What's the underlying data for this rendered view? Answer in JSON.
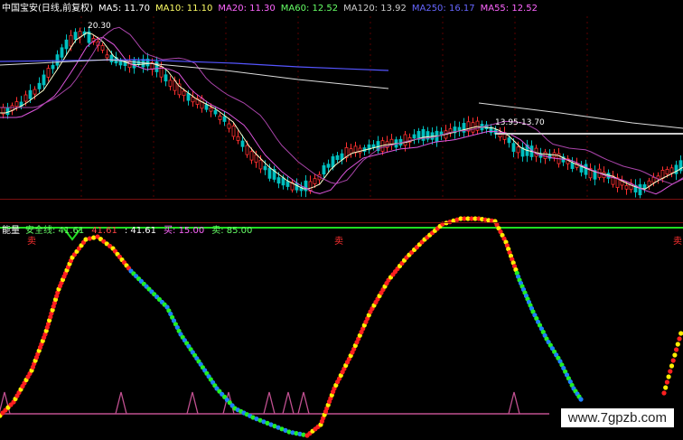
{
  "top_panel": {
    "title": "中国宝安(日线,前复权)",
    "ma": [
      {
        "label": "MA5: 11.70",
        "color": "#ffffff"
      },
      {
        "label": "MA10: 11.10",
        "color": "#ffff66"
      },
      {
        "label": "MA20: 11.30",
        "color": "#ff66ff"
      },
      {
        "label": "MA60: 12.52",
        "color": "#66ff66"
      },
      {
        "label": "MA120: 13.92",
        "color": "#cccccc"
      },
      {
        "label": "MA250: 16.17",
        "color": "#6666ff"
      },
      {
        "label": "MA55: 12.52",
        "color": "#ff66ff"
      }
    ],
    "price_high_label": "20.30",
    "price_range_label": "13.95-13.70"
  },
  "bottom_panel": {
    "title": "能量",
    "items": [
      {
        "label": "安全线: 41.61",
        "color": "#66ff66"
      },
      {
        "label": "41.61",
        "color": "#ff4444"
      },
      {
        "label": ": 41.61",
        "color": "#ffffff"
      },
      {
        "label": "买: 15.00",
        "color": "#ff66ff"
      },
      {
        "label": "卖: 85.00",
        "color": "#66ff66"
      }
    ],
    "sell_markers": [
      "卖",
      "卖",
      "卖"
    ]
  },
  "watermark": "www.7gpzb.com",
  "colors": {
    "up": "#ff3030",
    "down": "#00c0c0",
    "safety_line": "#22dd22",
    "buy_line": "#c05090"
  }
}
